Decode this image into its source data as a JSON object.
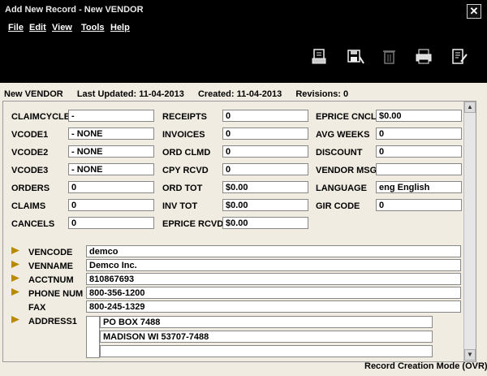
{
  "window": {
    "title": "Add New Record - New VENDOR",
    "close_glyph": "✕"
  },
  "menu": [
    "File",
    "Edit",
    "View",
    "Tools",
    "Help"
  ],
  "toolbar": [
    "print-record-icon",
    "save-icon",
    "delete-icon",
    "print-icon",
    "edit-notes-icon"
  ],
  "info": {
    "record": "New VENDOR",
    "last_updated": "Last Updated: 11-04-2013",
    "created": "Created: 11-04-2013",
    "revisions": "Revisions: 0"
  },
  "col1": [
    {
      "label": "CLAIMCYCLE",
      "value": "-"
    },
    {
      "label": "VCODE1",
      "value": "-  NONE"
    },
    {
      "label": "VCODE2",
      "value": "-  NONE"
    },
    {
      "label": "VCODE3",
      "value": "-  NONE"
    },
    {
      "label": "ORDERS",
      "value": "0"
    },
    {
      "label": "CLAIMS",
      "value": "0"
    },
    {
      "label": "CANCELS",
      "value": "0"
    }
  ],
  "col2": [
    {
      "label": "RECEIPTS",
      "value": "0"
    },
    {
      "label": "INVOICES",
      "value": "0"
    },
    {
      "label": "ORD CLMD",
      "value": "0"
    },
    {
      "label": "CPY RCVD",
      "value": "0"
    },
    {
      "label": "ORD TOT",
      "value": "$0.00"
    },
    {
      "label": "INV TOT",
      "value": "$0.00"
    },
    {
      "label": "EPRICE RCVD",
      "value": "$0.00"
    }
  ],
  "col3": [
    {
      "label": "EPRICE CNCL",
      "value": "$0.00"
    },
    {
      "label": "AVG WEEKS",
      "value": "0"
    },
    {
      "label": "DISCOUNT",
      "value": "0"
    },
    {
      "label": "VENDOR MSG",
      "value": ""
    },
    {
      "label": "LANGUAGE",
      "value": "eng  English"
    },
    {
      "label": "GIR CODE",
      "value": "0"
    }
  ],
  "vars": [
    {
      "label": "VENCODE",
      "value": "demco",
      "marker": true
    },
    {
      "label": "VENNAME",
      "value": "Demco Inc.",
      "marker": true
    },
    {
      "label": "ACCTNUM",
      "value": "810867693",
      "marker": true
    },
    {
      "label": "PHONE NUM",
      "value": "800-356-1200",
      "marker": true
    },
    {
      "label": "FAX",
      "value": "800-245-1329",
      "marker": false
    }
  ],
  "address": {
    "label": "ADDRESS1",
    "lines": [
      "PO BOX 7488",
      "MADISON  WI  53707-7488",
      ""
    ]
  },
  "status": "Record Creation Mode (OVR)"
}
